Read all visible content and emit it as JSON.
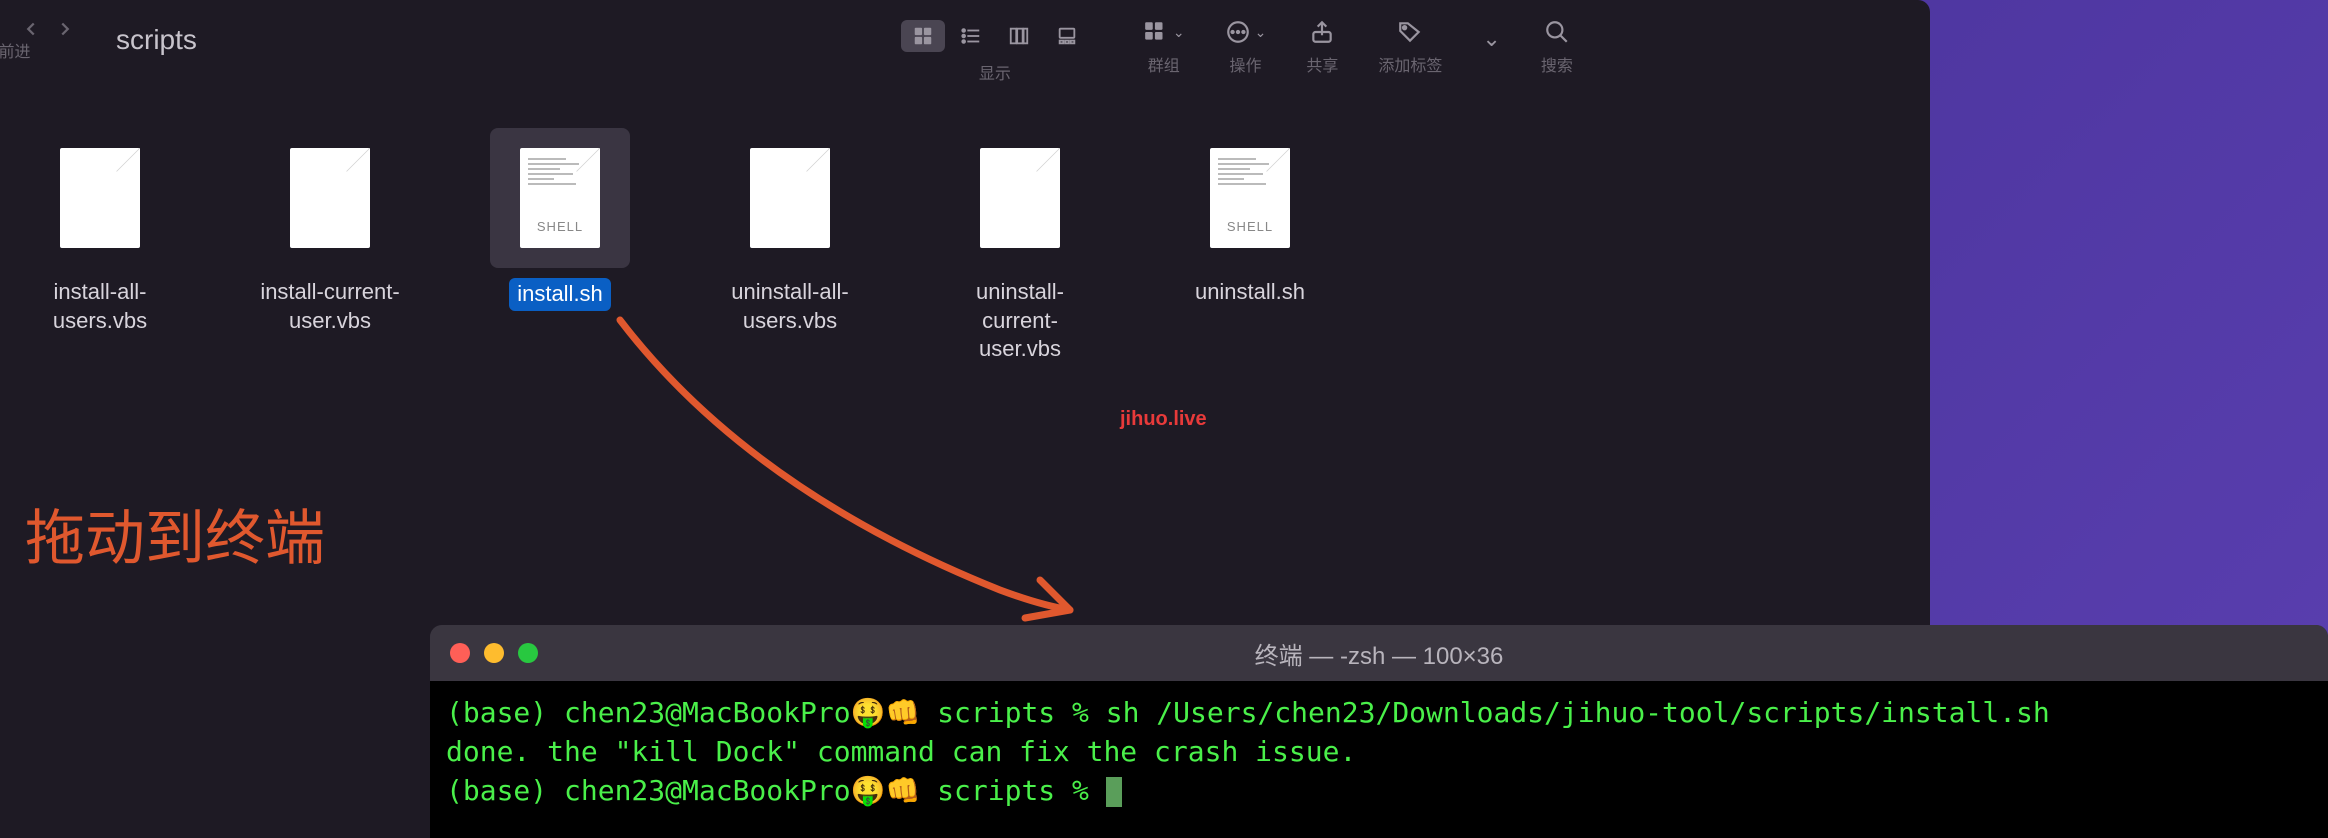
{
  "finder": {
    "nav_label": "返回/前进",
    "title": "scripts",
    "view_label": "显示",
    "group_label": "群组",
    "action_label": "操作",
    "share_label": "共享",
    "tags_label": "添加标签",
    "search_label": "搜索",
    "files": [
      {
        "name": "install-all-users.vbs",
        "type": "blank"
      },
      {
        "name": "install-current-user.vbs",
        "type": "blank"
      },
      {
        "name": "install.sh",
        "type": "shell",
        "selected": true
      },
      {
        "name": "uninstall-all-users.vbs",
        "type": "blank"
      },
      {
        "name": "uninstall-current-user.vbs",
        "type": "blank"
      },
      {
        "name": "uninstall.sh",
        "type": "shell"
      }
    ]
  },
  "annotation": {
    "text": "拖动到终端",
    "watermark": "jihuo.live"
  },
  "terminal": {
    "title": "终端 — -zsh — 100×36",
    "line1": "(base) chen23@MacBookPro🤑👊 scripts % sh /Users/chen23/Downloads/jihuo-tool/scripts/install.sh",
    "line2": "done. the \"kill Dock\" command can fix the crash issue.",
    "line3": "(base) chen23@MacBookPro🤑👊 scripts % "
  },
  "shell_icon_label": "SHELL"
}
